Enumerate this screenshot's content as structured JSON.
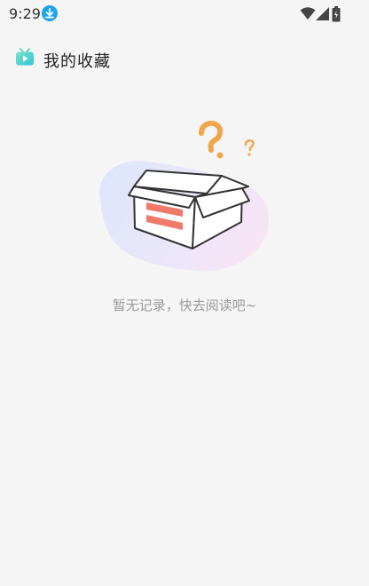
{
  "status_bar": {
    "time": "9:29",
    "icons": [
      "download-icon",
      "wifi-icon",
      "signal-icon",
      "battery-icon"
    ]
  },
  "app_bar": {
    "title": "我的收藏",
    "logo_icon": "tv-logo-icon"
  },
  "empty_state": {
    "message": "暂无记录，快去阅读吧~",
    "illustration": "empty-box-question-icon"
  },
  "colors": {
    "background": "#f5f5f5",
    "accent_blue": "#1aa6e8",
    "question_orange": "#f0a64b",
    "box_stripe": "#f07a6a",
    "text_gray": "#9a9a9a"
  }
}
